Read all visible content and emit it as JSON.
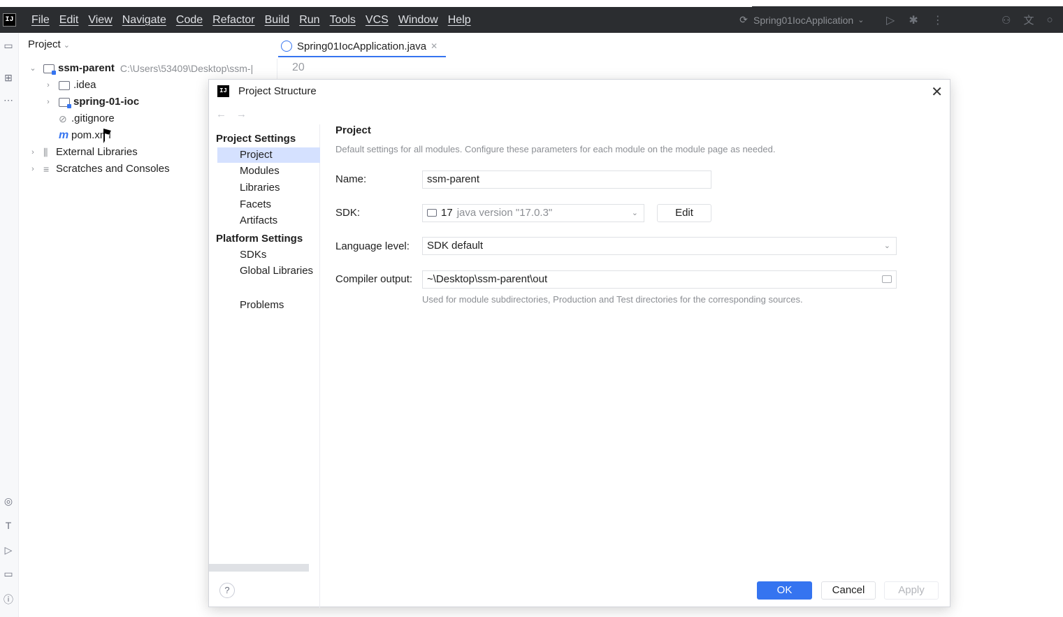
{
  "menubar": {
    "items": [
      "File",
      "Edit",
      "View",
      "Navigate",
      "Code",
      "Refactor",
      "Build",
      "Run",
      "Tools",
      "VCS",
      "Window",
      "Help"
    ],
    "run_config": "Spring01IocApplication"
  },
  "project_panel": {
    "header": "Project",
    "tree": [
      {
        "label": "ssm-parent",
        "path": "C:\\Users\\53409\\Desktop\\ssm-|"
      },
      {
        "label": ".idea"
      },
      {
        "label": "spring-01-ioc"
      },
      {
        "label": ".gitignore"
      },
      {
        "label": "pom.xml"
      },
      {
        "label": "External Libraries"
      },
      {
        "label": "Scratches and Consoles"
      }
    ]
  },
  "editor": {
    "tab_label": "Spring01IocApplication.java",
    "line_number": "20"
  },
  "dialog": {
    "title": "Project Structure",
    "sidebar": {
      "project_settings_header": "Project Settings",
      "project_settings": [
        "Project",
        "Modules",
        "Libraries",
        "Facets",
        "Artifacts"
      ],
      "platform_settings_header": "Platform Settings",
      "platform_settings": [
        "SDKs",
        "Global Libraries"
      ],
      "problems": "Problems"
    },
    "content": {
      "title": "Project",
      "description": "Default settings for all modules. Configure these parameters for each module on the module page as needed.",
      "name_label": "Name:",
      "name_value": "ssm-parent",
      "sdk_label": "SDK:",
      "sdk_version": "17",
      "sdk_detail": "java version \"17.0.3\"",
      "edit_label": "Edit",
      "language_level_label": "Language level:",
      "language_level_value": "SDK default",
      "compiler_output_label": "Compiler output:",
      "compiler_output_value": "~\\Desktop\\ssm-parent\\out",
      "compiler_output_hint": "Used for module subdirectories, Production and Test directories for the corresponding sources."
    },
    "buttons": {
      "help": "?",
      "ok": "OK",
      "cancel": "Cancel",
      "apply": "Apply"
    }
  },
  "colors": {
    "accent": "#3574f0",
    "menubar_bg": "#2b2d30",
    "selection": "#d5e1ff"
  }
}
